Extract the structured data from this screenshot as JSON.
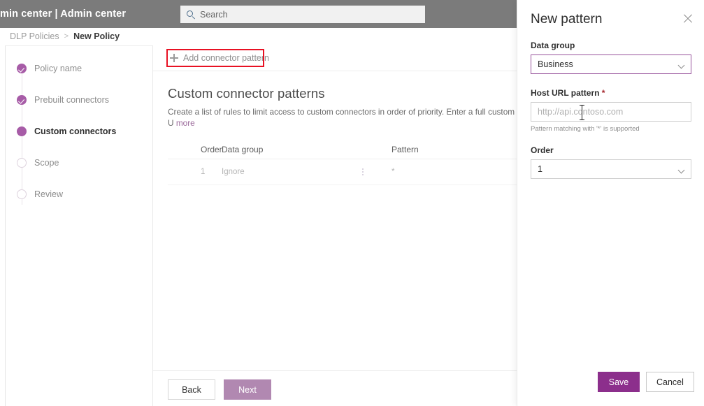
{
  "topbar": {
    "suite_title": "min center  |  Admin center",
    "search_placeholder": "Search",
    "search_icon": "search-icon"
  },
  "breadcrumb": {
    "parent": "DLP Policies",
    "separator": ">",
    "current": "New Policy"
  },
  "stepper": {
    "items": [
      {
        "label": "Policy name",
        "state": "done"
      },
      {
        "label": "Prebuilt connectors",
        "state": "done"
      },
      {
        "label": "Custom connectors",
        "state": "current"
      },
      {
        "label": "Scope",
        "state": "todo"
      },
      {
        "label": "Review",
        "state": "todo"
      }
    ]
  },
  "command_bar": {
    "add_label": "Add connector pattern",
    "add_icon": "plus-icon",
    "highlight_color": "#e81123"
  },
  "main": {
    "section_title": "Custom connector patterns",
    "section_desc": "Create a list of rules to limit access to custom connectors in order of priority. Enter a full custom connector U",
    "more_link": "more",
    "table": {
      "columns": [
        "Order",
        "Data group",
        "Pattern"
      ],
      "rows": [
        {
          "order": "1",
          "data_group": "Ignore",
          "pattern": "*",
          "menu_icon": "kebab-menu-icon"
        }
      ]
    },
    "footer": {
      "back_label": "Back",
      "next_label": "Next",
      "next_color": "#b188b1"
    }
  },
  "panel": {
    "title": "New pattern",
    "close_icon": "close-icon",
    "data_group": {
      "label": "Data group",
      "value": "Business",
      "chevron_icon": "chevron-down-icon",
      "focus_color": "#97529b"
    },
    "host_url": {
      "label": "Host URL pattern",
      "required_marker": "*",
      "placeholder": "http://api.contoso.com",
      "hint": "Pattern matching with '*' is supported"
    },
    "order": {
      "label": "Order",
      "value": "1",
      "chevron_icon": "chevron-down-icon"
    },
    "actions": {
      "save_label": "Save",
      "cancel_label": "Cancel",
      "save_color": "#8c2f8c"
    }
  }
}
